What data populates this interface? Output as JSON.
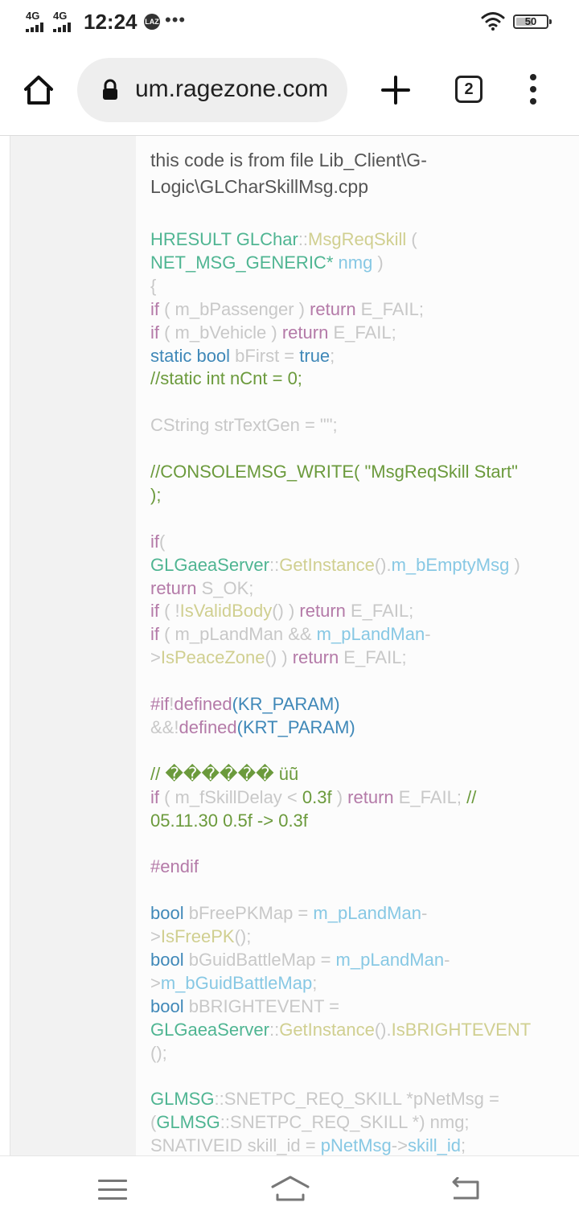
{
  "status_bar": {
    "signal_1": "4G",
    "signal_2": "4G",
    "time": "12:24",
    "badge": "LAZ",
    "more": "•••",
    "battery": "50"
  },
  "browser": {
    "url": "um.ragezone.com",
    "tab_count": "2"
  },
  "post": {
    "intro_line_1": "this code is from file Lib_Client\\G-",
    "intro_line_2": "Logic\\GLCharSkillMsg.cpp"
  },
  "code": [
    [
      {
        "t": "HRESULT GLChar",
        "c": "green"
      },
      {
        "t": "::",
        "c": "gray"
      },
      {
        "t": "MsgReqSkill",
        "c": "yel"
      },
      {
        "t": " (",
        "c": "gray"
      }
    ],
    [
      {
        "t": "NET_MSG_GENERIC*",
        "c": "green"
      },
      {
        "t": " nmg",
        "c": "lblue"
      },
      {
        "t": " )",
        "c": "gray"
      }
    ],
    [
      {
        "t": "{",
        "c": "gray"
      }
    ],
    [
      {
        "t": "if",
        "c": "pur"
      },
      {
        "t": " ( m_bPassenger ) ",
        "c": "gray"
      },
      {
        "t": "return",
        "c": "pur"
      },
      {
        "t": " E_FAIL;",
        "c": "gray"
      }
    ],
    [
      {
        "t": "if",
        "c": "pur"
      },
      {
        "t": " ( m_bVehicle ) ",
        "c": "gray"
      },
      {
        "t": "return",
        "c": "pur"
      },
      {
        "t": " E_FAIL;",
        "c": "gray"
      }
    ],
    [
      {
        "t": "static bool",
        "c": "blue"
      },
      {
        "t": " bFirst = ",
        "c": "gray"
      },
      {
        "t": "true",
        "c": "blue"
      },
      {
        "t": ";",
        "c": "gray"
      }
    ],
    [
      {
        "t": "//static int nCnt = 0;",
        "c": "com"
      }
    ],
    [],
    [
      {
        "t": "CString strTextGen = \"\";",
        "c": "gray"
      }
    ],
    [],
    [
      {
        "t": "//CONSOLEMSG_WRITE( \"MsgReqSkill Start\"",
        "c": "com"
      }
    ],
    [
      {
        "t": ");",
        "c": "com"
      }
    ],
    [],
    [
      {
        "t": "if",
        "c": "pur"
      },
      {
        "t": "(",
        "c": "gray"
      }
    ],
    [
      {
        "t": "GLGaeaServer",
        "c": "green"
      },
      {
        "t": "::",
        "c": "gray"
      },
      {
        "t": "GetInstance",
        "c": "yel"
      },
      {
        "t": "().",
        "c": "gray"
      },
      {
        "t": "m_bEmptyMsg",
        "c": "lblue"
      },
      {
        "t": " )",
        "c": "gray"
      }
    ],
    [
      {
        "t": "return",
        "c": "pur"
      },
      {
        "t": " S_OK;",
        "c": "gray"
      }
    ],
    [
      {
        "t": "if",
        "c": "pur"
      },
      {
        "t": " ( !",
        "c": "gray"
      },
      {
        "t": "IsValidBody",
        "c": "yel"
      },
      {
        "t": "() ) ",
        "c": "gray"
      },
      {
        "t": "return",
        "c": "pur"
      },
      {
        "t": " E_FAIL;",
        "c": "gray"
      }
    ],
    [
      {
        "t": "if",
        "c": "pur"
      },
      {
        "t": " ( m_pLandMan && ",
        "c": "gray"
      },
      {
        "t": "m_pLandMan",
        "c": "lblue"
      },
      {
        "t": "-",
        "c": "gray"
      }
    ],
    [
      {
        "t": ">",
        "c": "gray"
      },
      {
        "t": "IsPeaceZone",
        "c": "yel"
      },
      {
        "t": "() ) ",
        "c": "gray"
      },
      {
        "t": "return",
        "c": "pur"
      },
      {
        "t": " E_FAIL;",
        "c": "gray"
      }
    ],
    [],
    [
      {
        "t": "#if",
        "c": "pur"
      },
      {
        "t": "!",
        "c": "gray"
      },
      {
        "t": "defined",
        "c": "pur"
      },
      {
        "t": "(KR_PARAM)",
        "c": "blue"
      }
    ],
    [
      {
        "t": "&&!",
        "c": "gray"
      },
      {
        "t": "defined",
        "c": "pur"
      },
      {
        "t": "(KRT_PARAM)",
        "c": "blue"
      }
    ],
    [],
    [
      {
        "t": "// ������ üũ",
        "c": "com"
      }
    ],
    [
      {
        "t": "if",
        "c": "pur"
      },
      {
        "t": " ( m_fSkillDelay < ",
        "c": "gray"
      },
      {
        "t": "0.3f",
        "c": "com"
      },
      {
        "t": " ) ",
        "c": "gray"
      },
      {
        "t": "return",
        "c": "pur"
      },
      {
        "t": " E_FAIL; ",
        "c": "gray"
      },
      {
        "t": "//",
        "c": "com"
      }
    ],
    [
      {
        "t": "05.11.30 0.5f -> 0.3f",
        "c": "com"
      }
    ],
    [],
    [
      {
        "t": "#endif",
        "c": "pur"
      }
    ],
    [],
    [
      {
        "t": "bool",
        "c": "blue"
      },
      {
        "t": " bFreePKMap = ",
        "c": "gray"
      },
      {
        "t": "m_pLandMan",
        "c": "lblue"
      },
      {
        "t": "-",
        "c": "gray"
      }
    ],
    [
      {
        "t": ">",
        "c": "gray"
      },
      {
        "t": "IsFreePK",
        "c": "yel"
      },
      {
        "t": "();",
        "c": "gray"
      }
    ],
    [
      {
        "t": "bool",
        "c": "blue"
      },
      {
        "t": " bGuidBattleMap = ",
        "c": "gray"
      },
      {
        "t": "m_pLandMan",
        "c": "lblue"
      },
      {
        "t": "-",
        "c": "gray"
      }
    ],
    [
      {
        "t": ">",
        "c": "gray"
      },
      {
        "t": "m_bGuidBattleMap",
        "c": "lblue"
      },
      {
        "t": ";",
        "c": "gray"
      }
    ],
    [
      {
        "t": "bool",
        "c": "blue"
      },
      {
        "t": " bBRIGHTEVENT =",
        "c": "gray"
      }
    ],
    [
      {
        "t": "GLGaeaServer",
        "c": "green"
      },
      {
        "t": "::",
        "c": "gray"
      },
      {
        "t": "GetInstance",
        "c": "yel"
      },
      {
        "t": "().",
        "c": "gray"
      },
      {
        "t": "IsBRIGHTEVENT",
        "c": "yel"
      }
    ],
    [
      {
        "t": "();",
        "c": "gray"
      }
    ],
    [],
    [
      {
        "t": "GLMSG",
        "c": "green"
      },
      {
        "t": "::SNETPC_REQ_SKILL *pNetMsg =",
        "c": "gray"
      }
    ],
    [
      {
        "t": "(",
        "c": "gray"
      },
      {
        "t": "GLMSG",
        "c": "green"
      },
      {
        "t": "::SNETPC_REQ_SKILL *) nmg;",
        "c": "gray"
      }
    ],
    [
      {
        "t": "SNATIVEID skill_id = ",
        "c": "gray"
      },
      {
        "t": "pNetMsg",
        "c": "lblue"
      },
      {
        "t": "->",
        "c": "gray"
      },
      {
        "t": "skill_id",
        "c": "lblue"
      },
      {
        "t": ";",
        "c": "gray"
      }
    ]
  ]
}
